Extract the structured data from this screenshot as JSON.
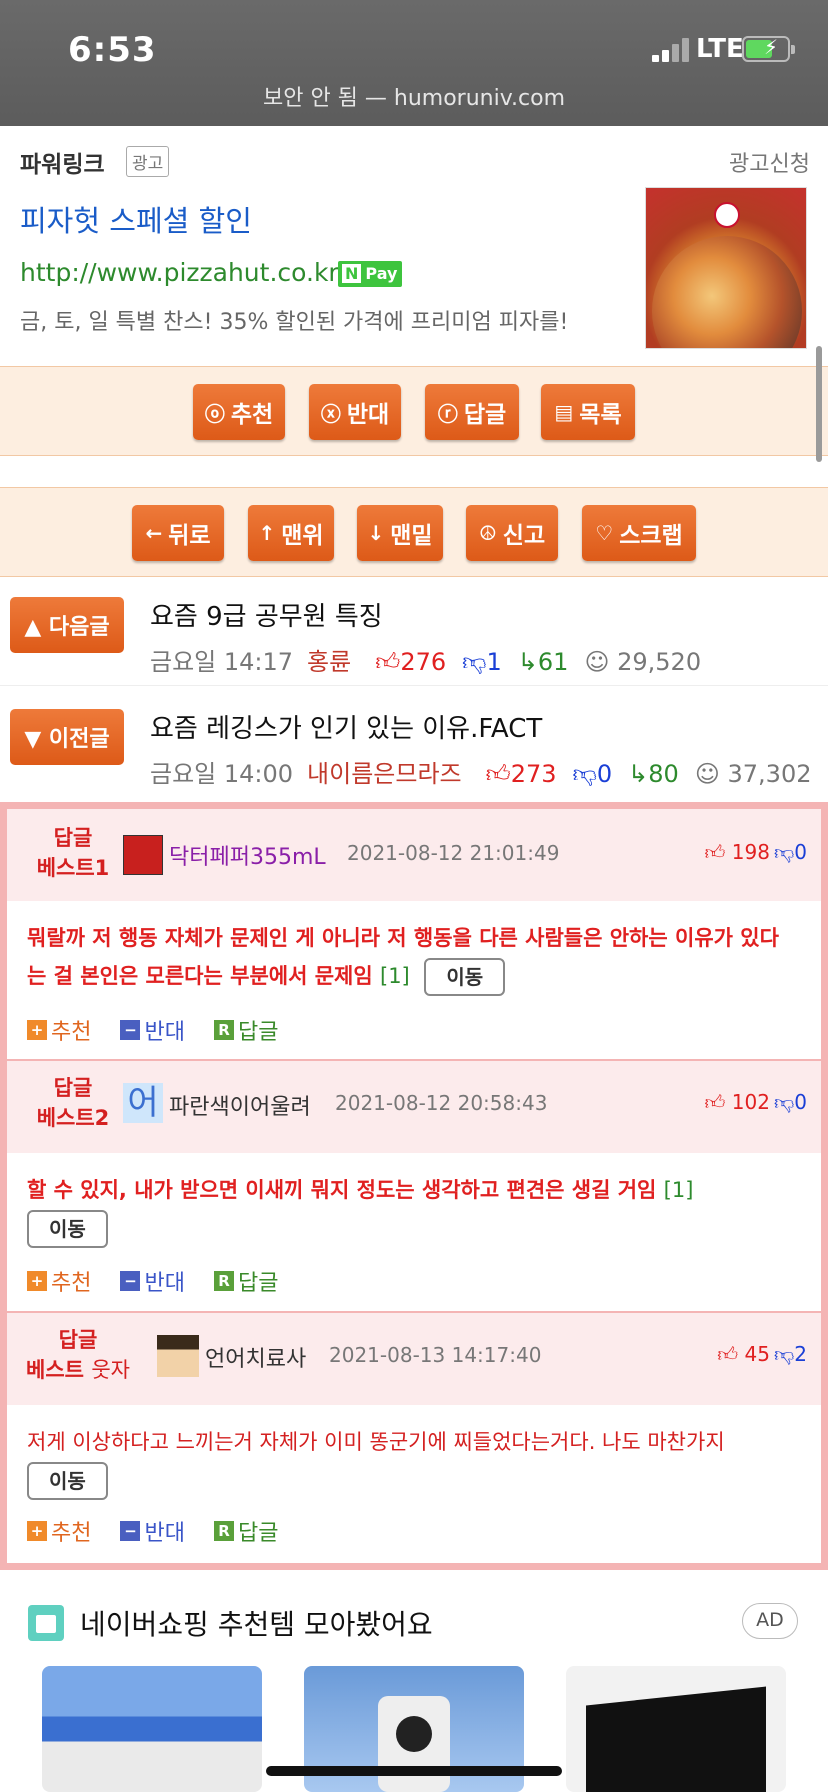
{
  "status": {
    "time": "6:53",
    "network": "LTE",
    "url": "보안 안 됨 — humoruniv.com"
  },
  "ad": {
    "header": "파워링크",
    "badge": "광고",
    "apply": "광고신청",
    "title": "피자헛 스페셜 할인",
    "link": "http://www.pizzahut.co.kr",
    "npay_n": "N",
    "npay_label": "Pay",
    "desc": "금, 토, 일 특별 찬스! 35% 할인된 가격에 프리미엄 피자를!"
  },
  "bar1": [
    {
      "icon": "ⓞ",
      "label": "추천"
    },
    {
      "icon": "ⓧ",
      "label": "반대"
    },
    {
      "icon": "ⓡ",
      "label": "답글"
    },
    {
      "icon": "▤",
      "label": "목록"
    }
  ],
  "bar2": [
    {
      "icon": "←",
      "label": "뒤로"
    },
    {
      "icon": "↑",
      "label": "맨위"
    },
    {
      "icon": "↓",
      "label": "맨밑"
    },
    {
      "icon": "☮",
      "label": "신고"
    },
    {
      "icon": "♡",
      "label": "스크랩"
    }
  ],
  "next": {
    "btn": "▲ 다음글",
    "title": "요즘 9급 공무원 특징",
    "date": "금요일 14:17",
    "author": "홍륜",
    "up": "276",
    "down": "1",
    "reply": "61",
    "views": "29,520"
  },
  "prev": {
    "btn": "▼ 이전글",
    "title": "요즘 레깅스가 인기 있는 이유.FACT",
    "date": "금요일 14:00",
    "author": "내이름은므라즈",
    "up": "273",
    "down": "0",
    "reply": "80",
    "views": "37,302"
  },
  "replies": [
    {
      "label1": "답글",
      "label2": "베스트1",
      "name": "닥터페퍼355mL",
      "date": "2021-08-12 21:01:49",
      "up": "198",
      "down": "0",
      "body": "뭐랄까 저 행동 자체가 문제인 게 아니라 저 행동을 다른 사람들은 안하는 이유가 있다는 걸 본인은 모른다는 부분에서 문제임",
      "count": "[1]",
      "move": "이동"
    },
    {
      "label1": "답글",
      "label2": "베스트2",
      "name": "파란색이어울려",
      "date": "2021-08-12 20:58:43",
      "up": "102",
      "down": "0",
      "avatar_char": "어",
      "body": "할 수 있지, 내가 받으면 이새끼 뭐지 정도는 생각하고 편견은 생길 거임",
      "count": "[1]",
      "move": "이동"
    },
    {
      "label1": "답글",
      "label2a": "베스트",
      "label2b": "웃자",
      "name": "언어치료사",
      "date": "2021-08-13 14:17:40",
      "up": "45",
      "down": "2",
      "body": "저게 이상하다고 느끼는거 자체가 이미 똥군기에 찌들었다는거다. 나도 마찬가지",
      "move": "이동"
    }
  ],
  "actions": {
    "rec": "추천",
    "opp": "반대",
    "reply": "답글",
    "rec_ic": "+",
    "opp_ic": "−",
    "reply_ic": "R"
  },
  "shopping": {
    "title": "네이버쇼핑 추천템 모아봤어요",
    "ad": "AD"
  },
  "colors": {
    "accent": "#e0661f",
    "best_border": "#f4b4b4",
    "red": "#e02020",
    "blue": "#1a3fd6",
    "green": "#2d8a2d"
  }
}
